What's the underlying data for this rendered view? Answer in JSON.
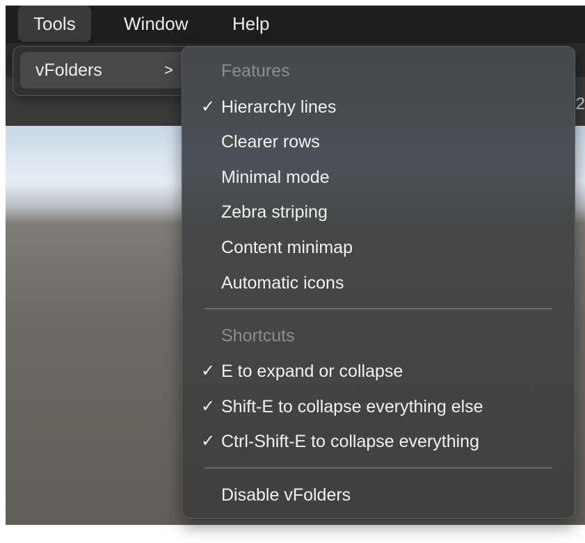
{
  "menubar": {
    "items": [
      {
        "label": "Tools"
      },
      {
        "label": "Window"
      },
      {
        "label": "Help"
      }
    ]
  },
  "scene": {
    "top_right_text": "2"
  },
  "tools_menu": {
    "item_label": "vFolders",
    "item_arrow": ">"
  },
  "submenu": {
    "sections": [
      {
        "header": "Features",
        "items": [
          {
            "label": "Hierarchy lines",
            "checked": true
          },
          {
            "label": "Clearer rows",
            "checked": false
          },
          {
            "label": "Minimal mode",
            "checked": false
          },
          {
            "label": "Zebra striping",
            "checked": false
          },
          {
            "label": "Content minimap",
            "checked": false
          },
          {
            "label": "Automatic icons",
            "checked": false
          }
        ]
      },
      {
        "header": "Shortcuts",
        "items": [
          {
            "label": "E to expand or collapse",
            "checked": true
          },
          {
            "label": "Shift-E to collapse everything else",
            "checked": true
          },
          {
            "label": "Ctrl-Shift-E to collapse everything",
            "checked": true
          }
        ]
      }
    ],
    "footer_item": {
      "label": "Disable vFolders"
    },
    "check_glyph": "✓"
  }
}
